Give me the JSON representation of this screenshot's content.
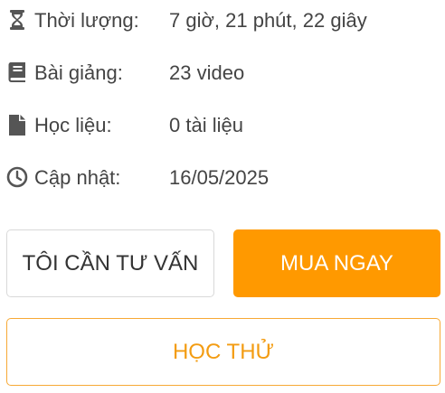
{
  "course_info": {
    "items": [
      {
        "icon": "hourglass-icon",
        "label": "Thời lượng:",
        "value": "7 giờ, 21 phút, 22 giây"
      },
      {
        "icon": "book-icon",
        "label": "Bài giảng:",
        "value": "23 video"
      },
      {
        "icon": "file-icon",
        "label": "Học liệu:",
        "value": "0 tài liệu"
      },
      {
        "icon": "clock-icon",
        "label": "Cập nhật:",
        "value": "16/05/2025"
      }
    ]
  },
  "actions": {
    "consult_label": "TÔI CẦN TƯ VẤN",
    "buy_label": "MUA NGAY",
    "trial_label": "HỌC THỬ"
  },
  "colors": {
    "primary_orange": "#ff9900",
    "trial_text": "#f39c12",
    "text": "#444444",
    "icon": "#555555"
  }
}
